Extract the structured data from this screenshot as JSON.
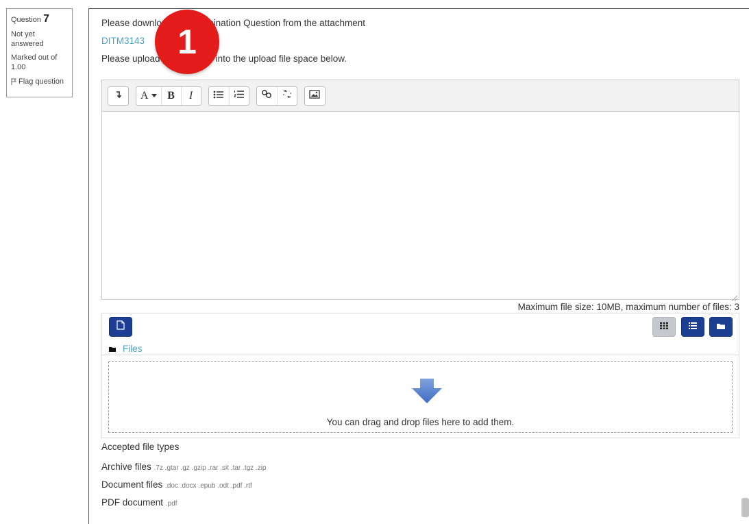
{
  "question": {
    "label": "Question",
    "number": "7",
    "state": "Not yet answered",
    "grade": "Marked out of 1.00",
    "flag_label": "Flag question"
  },
  "content": {
    "instruction_1": "Please download the Examination Question from the attachment",
    "attachment_link": "DITM3143",
    "instruction_2": "Please upload your answer into the upload file space below."
  },
  "badge": {
    "label": "1",
    "color": "#e31b1b"
  },
  "toolbar": {
    "groups": [
      [
        "collapse-icon"
      ],
      [
        "font-style-icon",
        "bold-icon",
        "italic-icon"
      ],
      [
        "unordered-list-icon",
        "ordered-list-icon"
      ],
      [
        "link-icon",
        "unlink-icon"
      ],
      [
        "image-icon"
      ]
    ],
    "bold_label": "B",
    "italic_label": "I",
    "font_label": "A"
  },
  "filemanager": {
    "max_size_text": "Maximum file size: 10MB, maximum number of files: 3",
    "path_label": "Files",
    "drop_text": "You can drag and drop files here to add them.",
    "accent_color": "#1c3f94"
  },
  "accepted": {
    "heading": "Accepted file types",
    "types": [
      {
        "name": "Archive files",
        "ext": ".7z .gtar .gz .gzip .rar .sit .tar .tgz .zip"
      },
      {
        "name": "Document files",
        "ext": ".doc .docx .epub .odt .pdf .rtf"
      },
      {
        "name": "PDF document",
        "ext": ".pdf"
      }
    ]
  }
}
